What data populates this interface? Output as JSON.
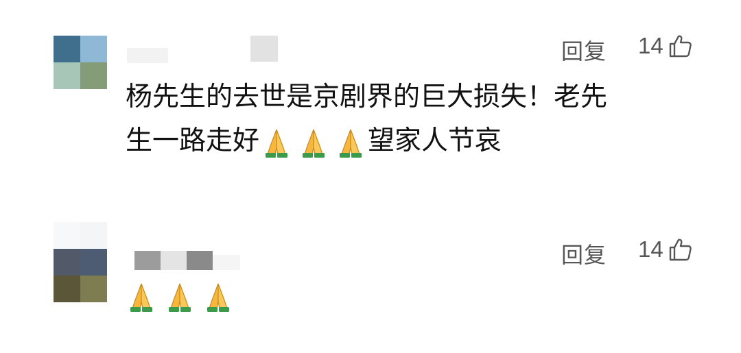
{
  "comments": [
    {
      "reply_label": "回复",
      "likes": "14",
      "text_line1": "杨先生的去世是京剧界的巨大损失！老先",
      "text_line2_before": "生一路走好",
      "text_line2_after": "望家人节哀",
      "emoji_name": "folded-hands-emoji",
      "emoji_count": 3
    },
    {
      "reply_label": "回复",
      "likes": "14",
      "emoji_name": "folded-hands-emoji",
      "emoji_count": 3
    }
  ],
  "colors": {
    "text": "#111111",
    "meta": "#555555",
    "background": "#ffffff",
    "emoji_hand": "#f6b73c",
    "emoji_cuff": "#3c9b4a"
  },
  "avatar_1_mosaic": [
    "#3f6f8d",
    "#8fb7d6",
    "#a7c6b8",
    "#849c77"
  ],
  "avatar_2_mosaic": [
    "#f6f8f9",
    "#f4f5f7",
    "#525a69",
    "#4d5c72",
    "#5b5637",
    "#7e7d52"
  ],
  "username_1_mosaic": [
    "#f4f4f4",
    "#e0e0e0"
  ],
  "username_2_mosaic": [
    "#9c9c9c",
    "#e4e4e4",
    "#8a8a8a"
  ]
}
